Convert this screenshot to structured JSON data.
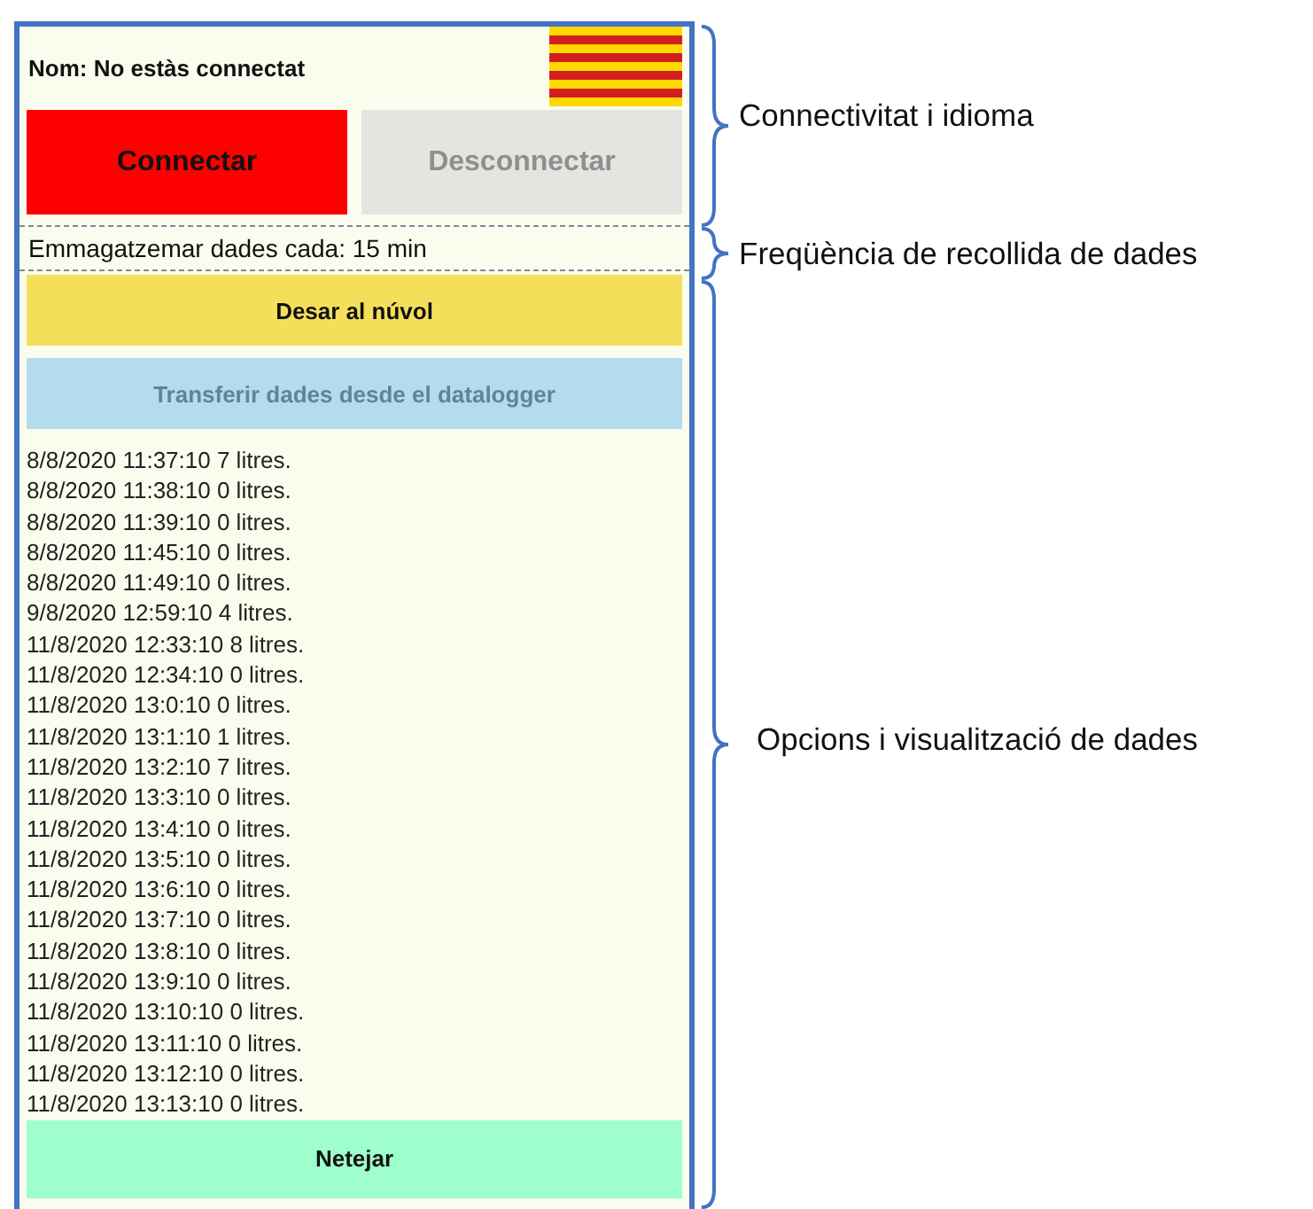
{
  "app": {
    "name_label": "Nom: No estàs connectat",
    "connection_buttons": [
      {
        "label": "Connectar",
        "disabled": false,
        "color": "#ff0000"
      },
      {
        "label": "Desconnectar",
        "disabled": true,
        "color": "#e3e5e0"
      }
    ],
    "frequency": "Emmagatzemar dades cada: 15 min",
    "actions": [
      {
        "label": "Desar al núvol",
        "disabled": false,
        "color": "#f5df5a"
      },
      {
        "label": "Transferir dades desde el datalogger",
        "disabled": true,
        "color": "#b3dcef"
      }
    ],
    "log": [
      "8/8/2020 11:37:10 7 litres.",
      "8/8/2020 11:38:10 0 litres.",
      "8/8/2020 11:39:10 0 litres.",
      "8/8/2020 11:45:10 0 litres.",
      "8/8/2020 11:49:10 0 litres.",
      "9/8/2020 12:59:10 4 litres.",
      "11/8/2020 12:33:10 8 litres.",
      "11/8/2020 12:34:10 0 litres.",
      "11/8/2020 13:0:10 0 litres.",
      "11/8/2020 13:1:10 1 litres.",
      "11/8/2020 13:2:10 7 litres.",
      "11/8/2020 13:3:10 0 litres.",
      "11/8/2020 13:4:10 0 litres.",
      "11/8/2020 13:5:10 0 litres.",
      "11/8/2020 13:6:10 0 litres.",
      "11/8/2020 13:7:10 0 litres.",
      "11/8/2020 13:8:10 0 litres.",
      "11/8/2020 13:9:10 0 litres.",
      "11/8/2020 13:10:10 0 litres.",
      "11/8/2020 13:11:10 0 litres.",
      "11/8/2020 13:12:10 0 litres.",
      "11/8/2020 13:13:10 0 litres."
    ],
    "clear_button": {
      "label": "Netejar",
      "color": "#9effcd"
    }
  },
  "annotations": [
    {
      "label": "Connectivitat i idioma"
    },
    {
      "label": "Freqüència de recollida de dades"
    },
    {
      "label": "Opcions i visualització de dades"
    }
  ]
}
